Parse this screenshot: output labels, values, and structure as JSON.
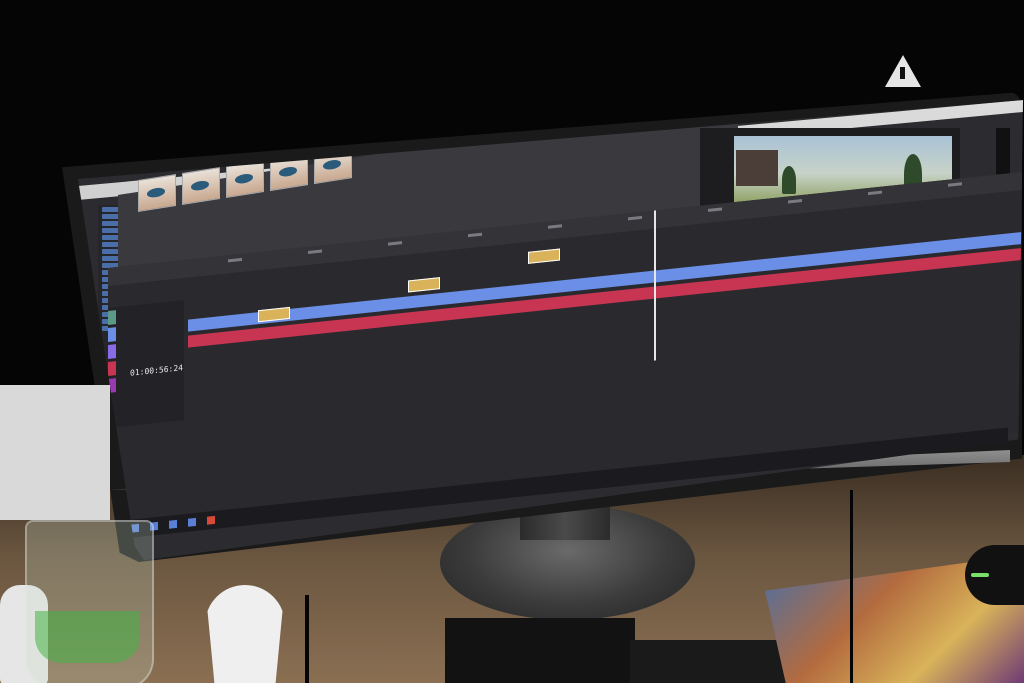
{
  "editor": {
    "timecode": "01:00:56:24",
    "media_thumbnails_count": 5,
    "tracks": [
      {
        "color": "#6b8ee6"
      },
      {
        "color": "#c83552"
      }
    ],
    "accent": "#6b8ee6",
    "audio_track_color": "#c83552"
  },
  "scene_objects": {
    "icons": [
      "warning-icon"
    ]
  }
}
